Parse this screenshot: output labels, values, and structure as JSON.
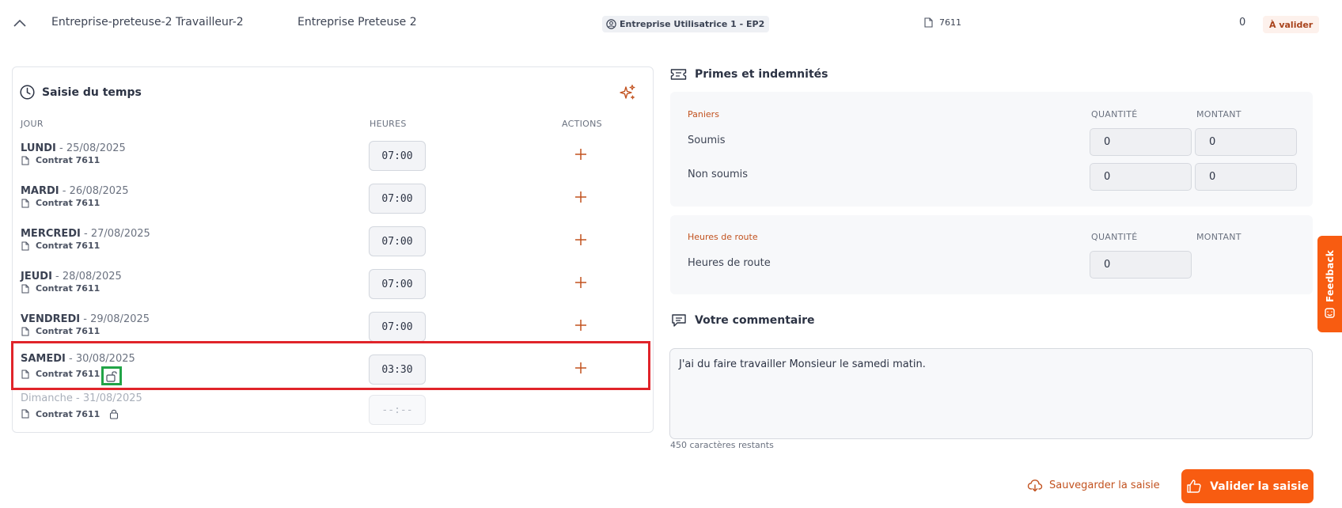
{
  "header": {
    "worker": "Entreprise-preteuse-2 Travailleur-2",
    "lender": "Entreprise Preteuse 2",
    "user_company": "Entreprise Utilisatrice 1 - EP2",
    "contract": "7611",
    "count": "0",
    "status": "À valider"
  },
  "time_entry": {
    "title": "Saisie du temps",
    "col_day": "JOUR",
    "col_hours": "HEURES",
    "col_actions": "ACTIONS",
    "days": [
      {
        "name": "LUNDI",
        "date": " - 25/08/2025",
        "contract": "Contrat 7611",
        "hours": "07:00"
      },
      {
        "name": "MARDI",
        "date": " - 26/08/2025",
        "contract": "Contrat 7611",
        "hours": "07:00"
      },
      {
        "name": "MERCREDI",
        "date": " - 27/08/2025",
        "contract": "Contrat 7611",
        "hours": "07:00"
      },
      {
        "name": "JEUDI",
        "date": " - 28/08/2025",
        "contract": "Contrat 7611",
        "hours": "07:00"
      },
      {
        "name": "VENDREDI",
        "date": " - 29/08/2025",
        "contract": "Contrat 7611",
        "hours": "07:00"
      },
      {
        "name": "SAMEDI",
        "date": " - 30/08/2025",
        "contract": "Contrat 7611",
        "hours": "03:30"
      },
      {
        "name": "Dimanche",
        "date": " - 31/08/2025",
        "contract": "Contrat 7611",
        "hours": "--:--"
      }
    ]
  },
  "bonuses": {
    "title": "Primes et indemnités",
    "col_quantity": "QUANTITÉ",
    "col_amount": "MONTANT",
    "paniers": {
      "label": "Paniers",
      "rows": [
        {
          "label": "Soumis",
          "quantity": "0",
          "amount": "0"
        },
        {
          "label": "Non soumis",
          "quantity": "0",
          "amount": "0"
        }
      ]
    },
    "route": {
      "label": "Heures de route",
      "rows": [
        {
          "label": "Heures de route",
          "quantity": "0"
        }
      ]
    }
  },
  "comment": {
    "title": "Votre commentaire",
    "text": "J'ai du faire travailler Monsieur le samedi matin.",
    "remaining": "450 caractères restants"
  },
  "actions": {
    "save": "Sauvegarder la saisie",
    "validate": "Valider la saisie"
  },
  "feedback": "Feedback",
  "colors": {
    "accent": "#f85c11",
    "accent_text": "#c2521f",
    "highlight_red": "#e0242a",
    "highlight_green": "#22a447"
  }
}
